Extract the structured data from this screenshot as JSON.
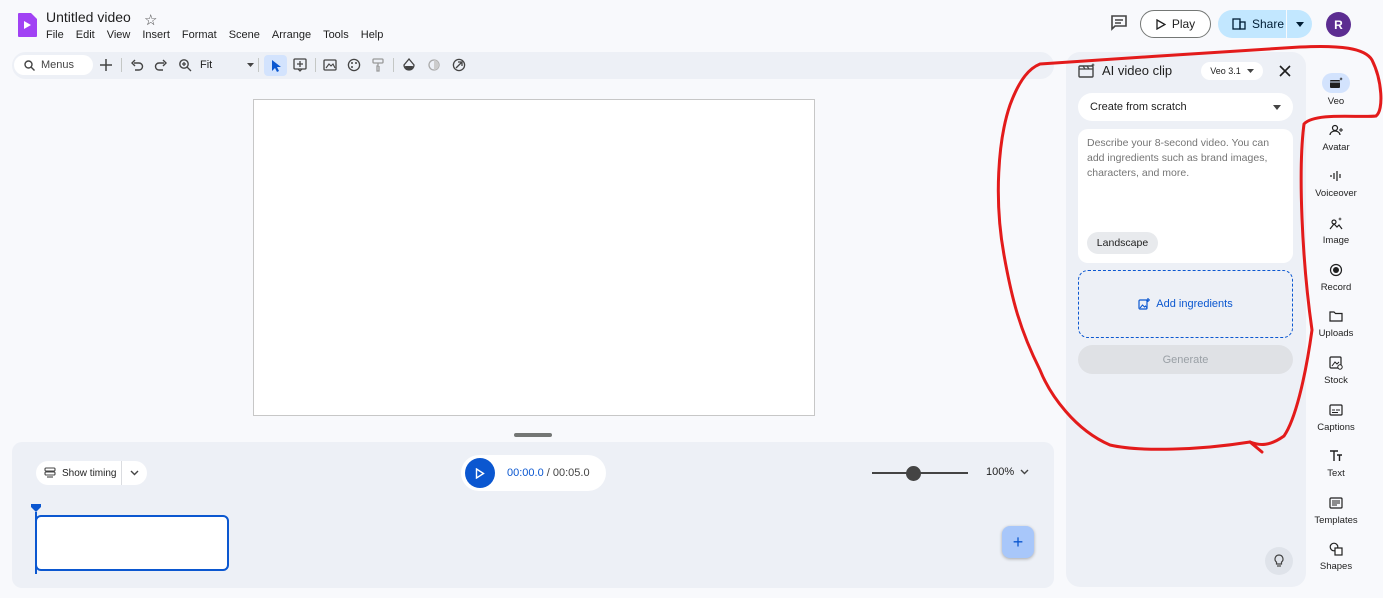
{
  "header": {
    "title": "Untitled video",
    "menu": [
      "File",
      "Edit",
      "View",
      "Insert",
      "Format",
      "Scene",
      "Arrange",
      "Tools",
      "Help"
    ],
    "play_label": "Play",
    "share_label": "Share",
    "avatar_initial": "R"
  },
  "toolbar": {
    "search_placeholder": "Menus",
    "zoom_label": "Fit",
    "icons": [
      "add-icon",
      "undo-icon",
      "redo-icon",
      "zoom-icon",
      "select-icon",
      "text-box-icon",
      "background-icon",
      "theme-icon",
      "paint-format-icon",
      "fill-icon",
      "opacity-icon",
      "link-icon"
    ]
  },
  "timeline": {
    "show_timing_label": "Show timing",
    "current_time": "00:00.0",
    "separator": "/",
    "total_time": "00:05.0",
    "zoom_percent": "100%"
  },
  "panel": {
    "title": "AI video clip",
    "model": "Veo 3.1",
    "mode": "Create from scratch",
    "prompt_placeholder": "Describe your 8-second video. You can add ingredients such as brand images, characters, and more.",
    "aspect_chip": "Landscape",
    "add_ingredients_label": "Add ingredients",
    "generate_label": "Generate"
  },
  "rail": [
    {
      "label": "Veo",
      "icon": "veo-icon",
      "active": true
    },
    {
      "label": "Avatar",
      "icon": "avatar-icon"
    },
    {
      "label": "Voiceover",
      "icon": "voiceover-icon"
    },
    {
      "label": "Image",
      "icon": "image-icon"
    },
    {
      "label": "Record",
      "icon": "record-icon"
    },
    {
      "label": "Uploads",
      "icon": "folder-icon"
    },
    {
      "label": "Stock",
      "icon": "stock-icon"
    },
    {
      "label": "Captions",
      "icon": "captions-icon"
    },
    {
      "label": "Text",
      "icon": "text-icon"
    },
    {
      "label": "Templates",
      "icon": "templates-icon"
    },
    {
      "label": "Shapes",
      "icon": "shapes-icon"
    }
  ],
  "colors": {
    "accent": "#0b57d0",
    "share_bg": "#c2e7ff",
    "annotation": "#e31b1b"
  }
}
